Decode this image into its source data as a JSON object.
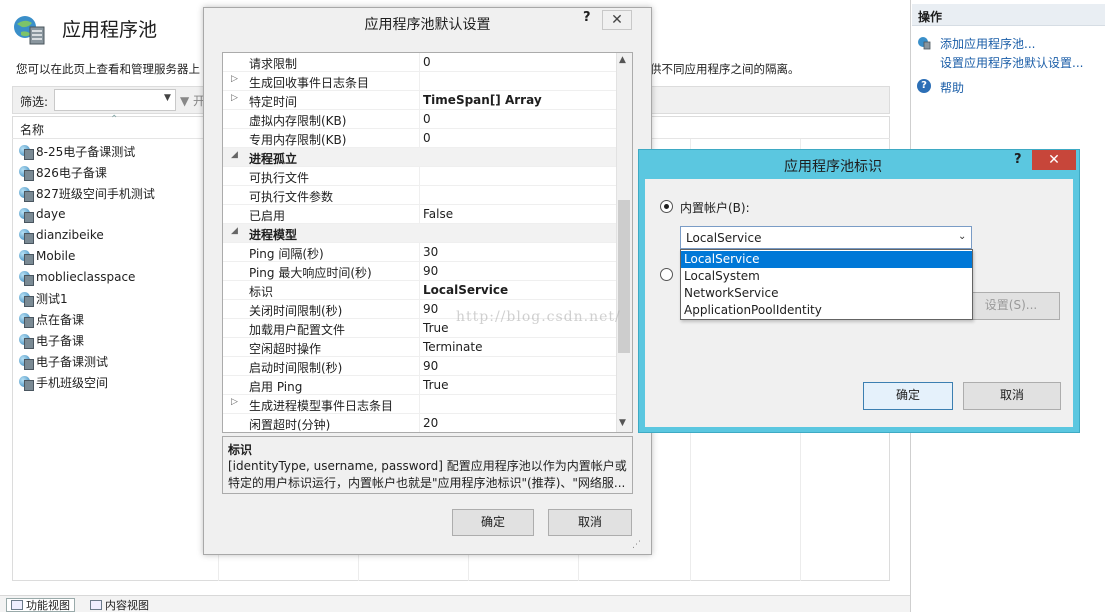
{
  "page": {
    "title": "应用程序池",
    "description": "您可以在此页上查看和管理服务器上",
    "description_right": "供不同应用程序之间的隔离。",
    "filter_label": "筛选:",
    "filter_go": "▼ 开",
    "column_name": "名称",
    "pools": [
      "8-25电子备课测试",
      "826电子备课",
      "827班级空间手机测试",
      "daye",
      "dianzibeike",
      "Mobile",
      "moblieclasspace",
      "测试1",
      "点在备课",
      "电子备课",
      "电子备课测试",
      "手机班级空间"
    ]
  },
  "status_bar": {
    "features_view": "功能视图",
    "content_view": "内容视图"
  },
  "actions": {
    "title": "操作",
    "add_pool": "添加应用程序池...",
    "default_settings": "设置应用程序池默认设置...",
    "help": "帮助"
  },
  "defaults_dialog": {
    "title": "应用程序池默认设置",
    "help": "?",
    "close": "✕",
    "rows": [
      {
        "type": "prop",
        "name": "请求限制",
        "value": "0",
        "expander": ""
      },
      {
        "type": "prop",
        "name": "生成回收事件日志条目",
        "value": "",
        "expander": "▷"
      },
      {
        "type": "prop",
        "name": "特定时间",
        "value": "TimeSpan[] Array",
        "expander": "▷",
        "bold": true
      },
      {
        "type": "prop",
        "name": "虚拟内存限制(KB)",
        "value": "0",
        "expander": ""
      },
      {
        "type": "prop",
        "name": "专用内存限制(KB)",
        "value": "0",
        "expander": ""
      },
      {
        "type": "cat",
        "name": "进程孤立",
        "value": "",
        "expander": "◢"
      },
      {
        "type": "prop",
        "name": "可执行文件",
        "value": "",
        "expander": ""
      },
      {
        "type": "prop",
        "name": "可执行文件参数",
        "value": "",
        "expander": ""
      },
      {
        "type": "prop",
        "name": "已启用",
        "value": "False",
        "expander": ""
      },
      {
        "type": "cat",
        "name": "进程模型",
        "value": "",
        "expander": "◢"
      },
      {
        "type": "prop",
        "name": "Ping 间隔(秒)",
        "value": "30",
        "expander": ""
      },
      {
        "type": "prop",
        "name": "Ping 最大响应时间(秒)",
        "value": "90",
        "expander": ""
      },
      {
        "type": "prop",
        "name": "标识",
        "value": "LocalService",
        "expander": "",
        "bold": true
      },
      {
        "type": "prop",
        "name": "关闭时间限制(秒)",
        "value": "90",
        "expander": ""
      },
      {
        "type": "prop",
        "name": "加载用户配置文件",
        "value": "True",
        "expander": ""
      },
      {
        "type": "prop",
        "name": "空闲超时操作",
        "value": "Terminate",
        "expander": ""
      },
      {
        "type": "prop",
        "name": "启动时间限制(秒)",
        "value": "90",
        "expander": ""
      },
      {
        "type": "prop",
        "name": "启用 Ping",
        "value": "True",
        "expander": ""
      },
      {
        "type": "prop",
        "name": "生成进程模型事件日志条目",
        "value": "",
        "expander": "▷"
      },
      {
        "type": "prop",
        "name": "闲置超时(分钟)",
        "value": "20",
        "expander": ""
      }
    ],
    "desc_title": "标识",
    "desc_text": "[identityType, username, password] 配置应用程序池以作为内置帐户或特定的用户标识运行，内置帐户也就是\"应用程序池标识\"(推荐)、\"网络服...",
    "ok": "确定",
    "cancel": "取消"
  },
  "identity_dialog": {
    "title": "应用程序池标识",
    "help": "?",
    "close": "✕",
    "builtin_label": "内置帐户(B):",
    "selected": "LocalService",
    "options": [
      "LocalService",
      "LocalSystem",
      "NetworkService",
      "ApplicationPoolIdentity"
    ],
    "settings_button": "设置(S)...",
    "ok": "确定",
    "cancel": "取消"
  },
  "watermark": "http://blog.csdn.net/"
}
